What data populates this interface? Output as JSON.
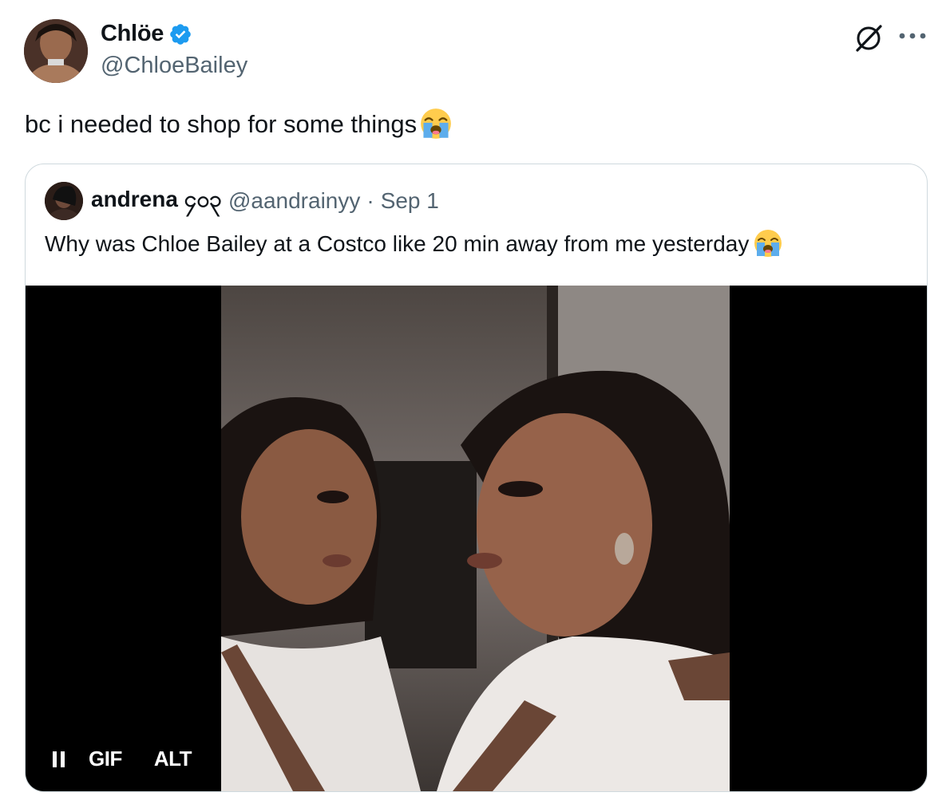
{
  "author": {
    "display_name": "Chlöe",
    "handle": "@ChloeBailey",
    "verified": true,
    "avatar_icon": "profile-photo"
  },
  "tweet": {
    "text": "bc i needed to shop for some things",
    "emoji": "loudly-crying-face"
  },
  "header_icons": [
    "grok-icon",
    "more-icon"
  ],
  "quoted": {
    "display_name": "andrena ၄၀၃",
    "handle": "@aandrainyy",
    "separator": "·",
    "date": "Sep 1",
    "text": "Why was Chloe Bailey at a Costco like 20 min away from me yesterday",
    "emoji": "loudly-crying-face"
  },
  "media": {
    "type": "gif",
    "gif_label": "GIF",
    "alt_label": "ALT",
    "pause_icon": "pause-icon"
  },
  "colors": {
    "text": "#0f1419",
    "secondary": "#536471",
    "border": "#cfd9de",
    "verified": "#1d9bf0"
  }
}
